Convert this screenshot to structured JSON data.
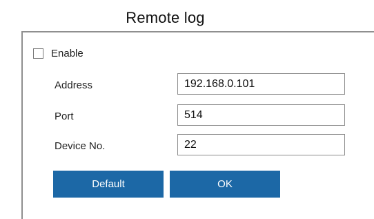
{
  "title": "Remote log",
  "enable": {
    "label": "Enable",
    "checked": false
  },
  "fields": {
    "address": {
      "label": "Address",
      "value": "192.168.0.101"
    },
    "port": {
      "label": "Port",
      "value": "514"
    },
    "device_no": {
      "label": "Device No.",
      "value": "22"
    }
  },
  "buttons": {
    "default_label": "Default",
    "ok_label": "OK"
  },
  "colors": {
    "button_bg": "#1c68a6",
    "button_text": "#ffffff",
    "panel_border": "#8f8f8f"
  }
}
